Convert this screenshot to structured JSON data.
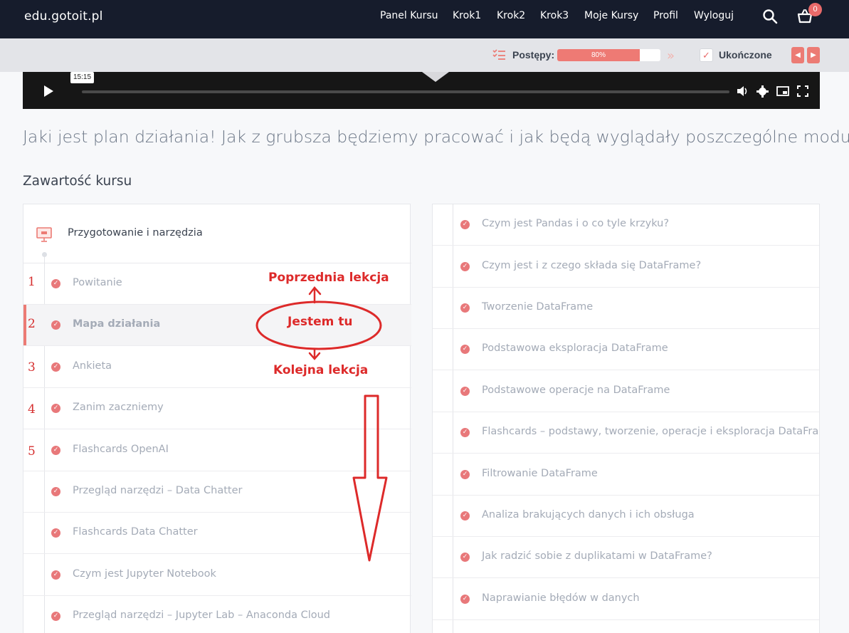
{
  "header": {
    "brand": "edu.gotoit.pl",
    "nav": [
      "Panel Kursu",
      "Krok1",
      "Krok2",
      "Krok3",
      "Moje Kursy",
      "Profil",
      "Wyloguj"
    ],
    "cart_count": "0",
    "icons": [
      "search-icon",
      "cart-icon"
    ]
  },
  "progress": {
    "label": "Postępy:",
    "percent_text": "80%",
    "value": 0.8,
    "complete_label": "Ukończone",
    "checkmark": "✓",
    "prev": "◀",
    "next": "▶",
    "skip": "»"
  },
  "player": {
    "time": "15:15"
  },
  "headline": "Jaki jest plan działania! Jak z grubsza będziemy pracować i jak będą wyglądały poszczególne moduły.",
  "section_title": "Zawartość kursu",
  "module": {
    "title": "Przygotowanie i narzędzia",
    "lessons": [
      {
        "label": "Powitanie"
      },
      {
        "label": "Mapa działania",
        "active": true
      },
      {
        "label": "Ankieta"
      },
      {
        "label": "Zanim zaczniemy"
      },
      {
        "label": "Flashcards OpenAI"
      },
      {
        "label": "Przegląd narzędzi – Data Chatter"
      },
      {
        "label": "Flashcards Data Chatter"
      },
      {
        "label": "Czym jest Jupyter Notebook"
      },
      {
        "label": "Przegląd narzędzi – Jupyter Lab – Anaconda Cloud"
      }
    ]
  },
  "right_lessons": [
    "Czym jest Pandas i o co tyle krzyku?",
    "Czym jest i z czego składa się DataFrame?",
    "Tworzenie DataFrame",
    "Podstawowa eksploracja DataFrame",
    "Podstawowe operacje na DataFrame",
    "Flashcards – podstawy, tworzenie, operacje i eksploracja DataFrame",
    "Filtrowanie DataFrame",
    "Analiza brakujących danych i ich obsługa",
    "Jak radzić sobie z duplikatami w DataFrame?",
    "Naprawianie błędów w danych"
  ],
  "annotations": {
    "prev_label": "Poprzednia lekcja",
    "here_label": "Jestem tu",
    "next_label": "Kolejna lekcja",
    "numbers": [
      "1",
      "2",
      "3",
      "4",
      "5"
    ],
    "color": "#dd2a2a"
  },
  "colors": {
    "accent": "#ec7b74",
    "nav_bg": "#161c2c",
    "text_muted": "#a4abb7"
  }
}
